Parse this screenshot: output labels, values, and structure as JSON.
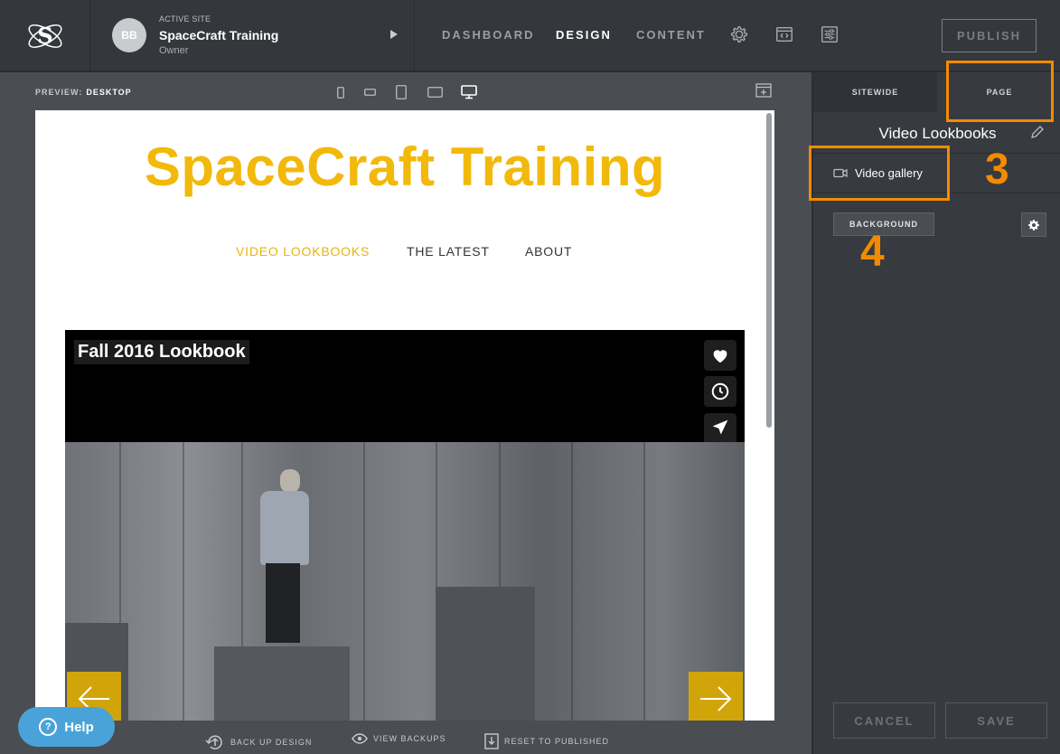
{
  "header": {
    "active_site_kicker": "ACTIVE SITE",
    "avatar_initials": "BB",
    "site_name": "SpaceCraft Training",
    "site_role": "Owner",
    "nav": [
      "DASHBOARD",
      "DESIGN",
      "CONTENT"
    ],
    "active_nav": "DESIGN",
    "publish_label": "PUBLISH",
    "icons": [
      "gear-icon",
      "code-icon",
      "sliders-icon"
    ]
  },
  "preview": {
    "label": "PREVIEW:",
    "mode": "DESKTOP",
    "devices": [
      "phone-portrait-icon",
      "phone-landscape-icon",
      "tablet-portrait-icon",
      "tablet-landscape-icon",
      "desktop-icon"
    ],
    "active_device": "desktop-icon"
  },
  "site": {
    "brand_title": "SpaceCraft Training",
    "menu": [
      "VIDEO LOOKBOOKS",
      "THE LATEST",
      "ABOUT"
    ],
    "active_menu": "VIDEO LOOKBOOKS",
    "gallery_title": "Fall 2016 Lookbook",
    "brand_color": "#f2b90b"
  },
  "bottom_bar": {
    "backup": "BACK UP DESIGN",
    "view_backups": "VIEW BACKUPS",
    "reset": "RESET TO PUBLISHED",
    "help": "Help"
  },
  "panel": {
    "tabs": [
      "SITEWIDE",
      "PAGE"
    ],
    "active_tab": "PAGE",
    "page_title": "Video Lookbooks",
    "section_item": "Video gallery",
    "background_button": "BACKGROUND",
    "cancel": "CANCEL",
    "save": "SAVE"
  },
  "annotations": {
    "marker_3": "3",
    "marker_4": "4",
    "color": "#f28b00"
  }
}
